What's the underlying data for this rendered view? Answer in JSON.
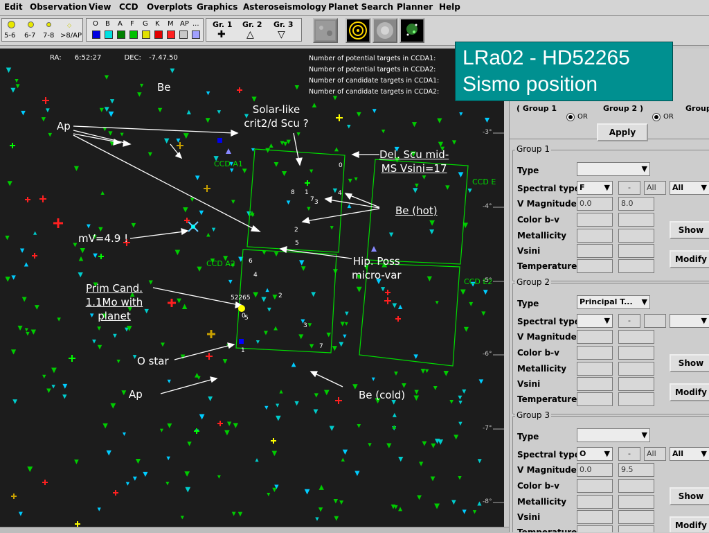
{
  "menu": [
    "Edit",
    "Observation",
    "View",
    "CCD",
    "Overplots",
    "Graphics",
    "Asteroseismology",
    "Planet Search",
    "Planner",
    "Help"
  ],
  "toolbar": {
    "mag_labels": [
      "5-6",
      "6-7",
      "7-8",
      ">8/AP"
    ],
    "spec_labels": [
      "O",
      "B",
      "A",
      "F",
      "G",
      "K",
      "M",
      "AP",
      "..."
    ],
    "spec_colors": [
      "#0000e0",
      "#00e0e0",
      "#008000",
      "#00c000",
      "#e0e000",
      "#e00000",
      "#ff2020",
      "#c8c8c8",
      "#a0a0ff"
    ],
    "groups": [
      {
        "label": "Gr. 1",
        "symbol": "✚"
      },
      {
        "label": "Gr. 2",
        "symbol": "△"
      },
      {
        "label": "Gr. 3",
        "symbol": "▽"
      }
    ]
  },
  "sky": {
    "ra_label": "RA:",
    "ra_value": "6:52:27",
    "dec_label": "DEC:",
    "dec_value": "-7.47.50",
    "counts": [
      "Number of potential targets in CCDA1:",
      "Number of potential targets in CCDA2:",
      "Number of candidate targets in CCDA1:",
      "Number of candidate targets in CCDA2:"
    ],
    "ccd_labels": {
      "a1": "CCD A1",
      "a2": "CCD A2",
      "e1": "CCD E",
      "e2": "CCD E2"
    },
    "dec_ticks": [
      "-3°",
      "-4°",
      "-5°",
      "-6°",
      "-7°",
      "-8°"
    ],
    "numbers_a1": [
      "0",
      "8",
      "1",
      "7",
      "3",
      "4",
      "2",
      "5"
    ],
    "numbers_a2": [
      "6",
      "4",
      "2",
      "3",
      "7",
      "1",
      "0",
      "5",
      "52265"
    ],
    "annotations": {
      "be": "Be",
      "ap1": "Ap",
      "solar1": "Solar-like",
      "solar2": "crit2/d Scu ?",
      "del1": "Del. Scu mid-",
      "del2": "MS Vsini=17",
      "behot": "Be (hot)",
      "mv": "mV=4.9 !",
      "hip1": "Hip. Poss",
      "hip2": "micro-var",
      "prim1": "Prim Cand.",
      "prim2": "1.1Mo with",
      "prim3": "planet",
      "ostar": "O star",
      "ap2": "Ap",
      "becold": "Be (cold)"
    }
  },
  "banner": {
    "line1": "LRa02 - HD52265",
    "line2": "Sismo position"
  },
  "panel": {
    "top": {
      "g1": "( Group 1",
      "g2": "Group 2 )",
      "g3": "Group",
      "or": "OR",
      "apply": "Apply"
    },
    "row_labels": [
      "Type",
      "Spectral type",
      "V Magnitude",
      "Color b-v",
      "Metallicity",
      "Vsini",
      "Temperature"
    ],
    "show": "Show",
    "modify": "Modify",
    "dash": "-",
    "all": "All",
    "groups": [
      {
        "title": "Group 1",
        "type": "",
        "spec": "F",
        "all_field": "All",
        "all_sel": "All",
        "vmin": "0.0",
        "vmax": "8.0"
      },
      {
        "title": "Group 2",
        "type": "Principal T...",
        "spec": "",
        "all_field": "",
        "all_sel": "",
        "vmin": "",
        "vmax": ""
      },
      {
        "title": "Group 3",
        "type": "",
        "spec": "O",
        "all_field": "All",
        "all_sel": "All",
        "vmin": "0.0",
        "vmax": "9.5"
      }
    ]
  }
}
